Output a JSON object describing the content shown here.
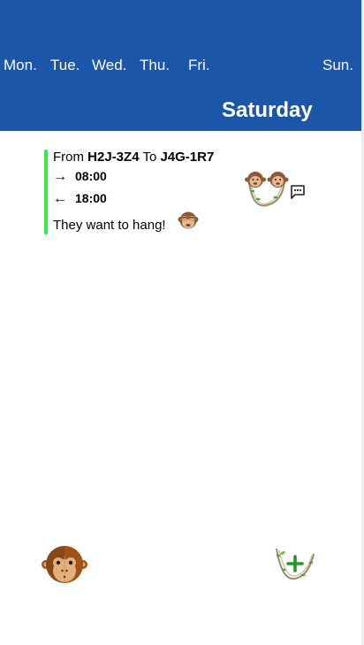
{
  "header": {
    "days": [
      "Mon.",
      "Tue.",
      "Wed.",
      "Thu.",
      "Fri.",
      "Sun."
    ],
    "selected_day": "Saturday",
    "background_color": "#1b56a8"
  },
  "event": {
    "from_label": "From",
    "from_code": "H2J-3Z4",
    "to_label": "To",
    "to_code": "J4G-1R7",
    "departure_arrow": "→",
    "departure_time": "08:00",
    "return_arrow": "←",
    "return_time": "18:00",
    "note": "They want to hang!",
    "bar_color": "#33ee44",
    "note_icon": "see-no-evil-monkey-icon",
    "participants_icon": "two-monkeys-on-vine-icon",
    "chat_icon": "chat-bubble-icon"
  },
  "footer": {
    "profile_icon": "monkey-face-icon",
    "add_icon": "vine-plus-icon"
  }
}
